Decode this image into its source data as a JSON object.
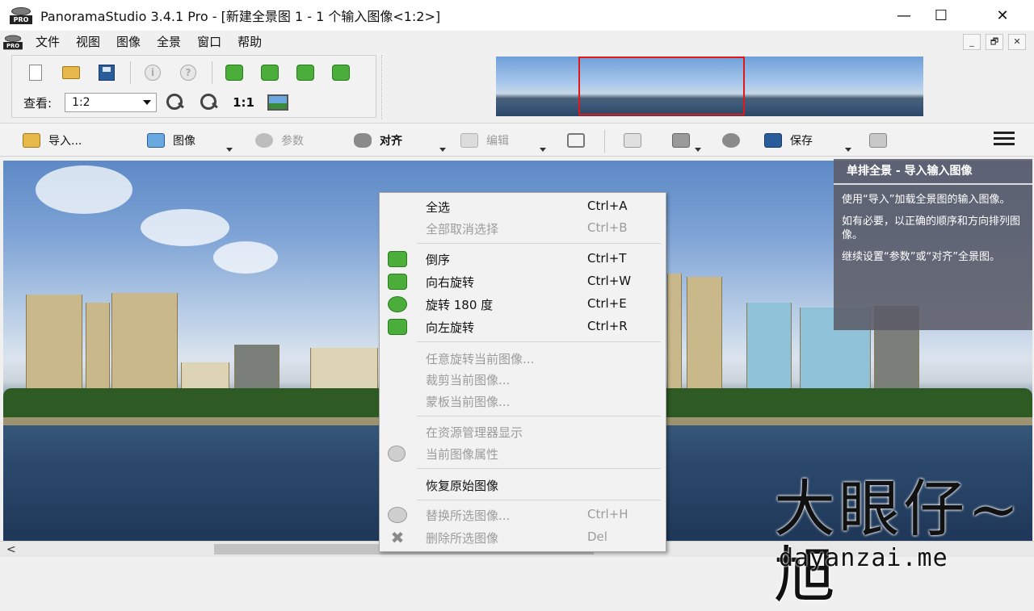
{
  "window": {
    "title": "PanoramaStudio 3.4.1 Pro - [新建全景图 1 - 1 个输入图像<1:2>]",
    "minimize": "—",
    "maximize": "☐",
    "close": "✕",
    "icon_label": "PRO"
  },
  "menu": {
    "items": [
      "文件",
      "视图",
      "图像",
      "全景",
      "窗口",
      "帮助"
    ],
    "mdi_buttons": [
      "_",
      "🗗",
      "✕"
    ]
  },
  "toolbar": {
    "view_label": "查看:",
    "zoom_value": "1:2",
    "actual_size_label": "1:1"
  },
  "toolbar2": {
    "import": "导入...",
    "image": "图像",
    "params": "参数",
    "align": "对齐",
    "edit": "编辑",
    "save": "保存"
  },
  "info_panel": {
    "title": "单排全景 - 导入输入图像",
    "paragraphs": [
      "使用“导入”加载全景图的输入图像。",
      "如有必要，以正确的顺序和方向排列图像。",
      "继续设置“参数”或“对齐”全景图。"
    ]
  },
  "context_menu": {
    "items": [
      {
        "label": "全选",
        "shortcut": "Ctrl+A",
        "enabled": true,
        "icon": ""
      },
      {
        "label": "全部取消选择",
        "shortcut": "Ctrl+B",
        "enabled": false,
        "icon": ""
      },
      {
        "label": "倒序",
        "shortcut": "Ctrl+T",
        "enabled": true,
        "icon": "reverse-order-icon"
      },
      {
        "label": "向右旋转",
        "shortcut": "Ctrl+W",
        "enabled": true,
        "icon": "rotate-right-icon"
      },
      {
        "label": "旋转 180 度",
        "shortcut": "Ctrl+E",
        "enabled": true,
        "icon": "rotate-180-icon"
      },
      {
        "label": "向左旋转",
        "shortcut": "Ctrl+R",
        "enabled": true,
        "icon": "rotate-left-icon"
      },
      {
        "label": "任意旋转当前图像...",
        "shortcut": "",
        "enabled": false,
        "icon": ""
      },
      {
        "label": "裁剪当前图像...",
        "shortcut": "",
        "enabled": false,
        "icon": ""
      },
      {
        "label": "蒙板当前图像...",
        "shortcut": "",
        "enabled": false,
        "icon": ""
      },
      {
        "label": "在资源管理器显示",
        "shortcut": "",
        "enabled": false,
        "icon": ""
      },
      {
        "label": "当前图像属性",
        "shortcut": "",
        "enabled": false,
        "icon": "info-icon"
      },
      {
        "label": "恢复原始图像",
        "shortcut": "",
        "enabled": true,
        "icon": ""
      },
      {
        "label": "替换所选图像...",
        "shortcut": "Ctrl+H",
        "enabled": false,
        "icon": "replace-icon"
      },
      {
        "label": "删除所选图像",
        "shortcut": "Del",
        "enabled": false,
        "icon": "delete-icon"
      }
    ]
  },
  "watermark": {
    "chinese": "大眼仔~旭",
    "url": "dayanzai.me"
  },
  "scrollbar": {
    "left_arrow": "<",
    "right_arrow": ">"
  },
  "colors": {
    "selection_frame": "#e01818",
    "info_panel_bg": "#5c5c68",
    "accent_green": "#4cae3a"
  }
}
